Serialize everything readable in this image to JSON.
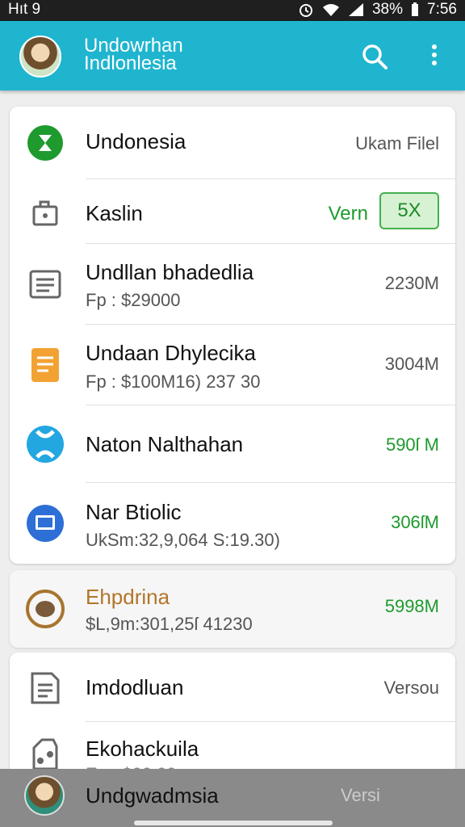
{
  "status_bar": {
    "left_text": "Hıt 9",
    "battery": "38%",
    "time": "7:56"
  },
  "app_bar": {
    "title_line1": "Undowrhan",
    "title_line2": "Indlonlesia",
    "search_icon": "search-icon",
    "more_icon": "more-vert-icon"
  },
  "card1": {
    "rows": [
      {
        "title": "Undonesia",
        "right": "Ukam Filel",
        "icon": "hourglass-icon",
        "icon_color": "#1e9a2e"
      },
      {
        "title": "Kaslin",
        "right_label": "Vern",
        "badge": "5X",
        "icon": "lock-icon"
      },
      {
        "title": "Undllan bhadedlia",
        "subtitle": "Fp : $29000",
        "right": "2230M",
        "icon": "document-icon"
      },
      {
        "title": "Undaan Dhylecika",
        "subtitle": "Fp : $100M16) 237 30",
        "right": "3004M",
        "icon": "document-orange-icon",
        "icon_color": "#f2a233"
      },
      {
        "title": "Naton Nalthahan",
        "right": "590ſ M",
        "right_green": true,
        "icon": "puzzle-icon",
        "icon_color": "#23a7e0"
      },
      {
        "title": "Nar Btiolic",
        "subtitle": "UkSm:32,9,064 S:19.30)",
        "right": "306ſM",
        "right_green": true,
        "icon": "monitor-icon",
        "icon_color": "#2d6fd6"
      }
    ]
  },
  "highlight_row": {
    "title": "Ehpdrina",
    "subtitle": "$L,9m:301,25ſ 41230",
    "right": "5998M",
    "icon": "coin-icon",
    "title_color": "#b2752a"
  },
  "card2": {
    "rows": [
      {
        "title": "Imdodluan",
        "right": "Versou",
        "icon": "document-icon"
      },
      {
        "title": "Ekohackuila",
        "subtitle": "Ep : $00 00",
        "icon": "tools-icon"
      }
    ]
  },
  "bottom_bar": {
    "name": "Undgwadmsia",
    "version": "Versi"
  }
}
